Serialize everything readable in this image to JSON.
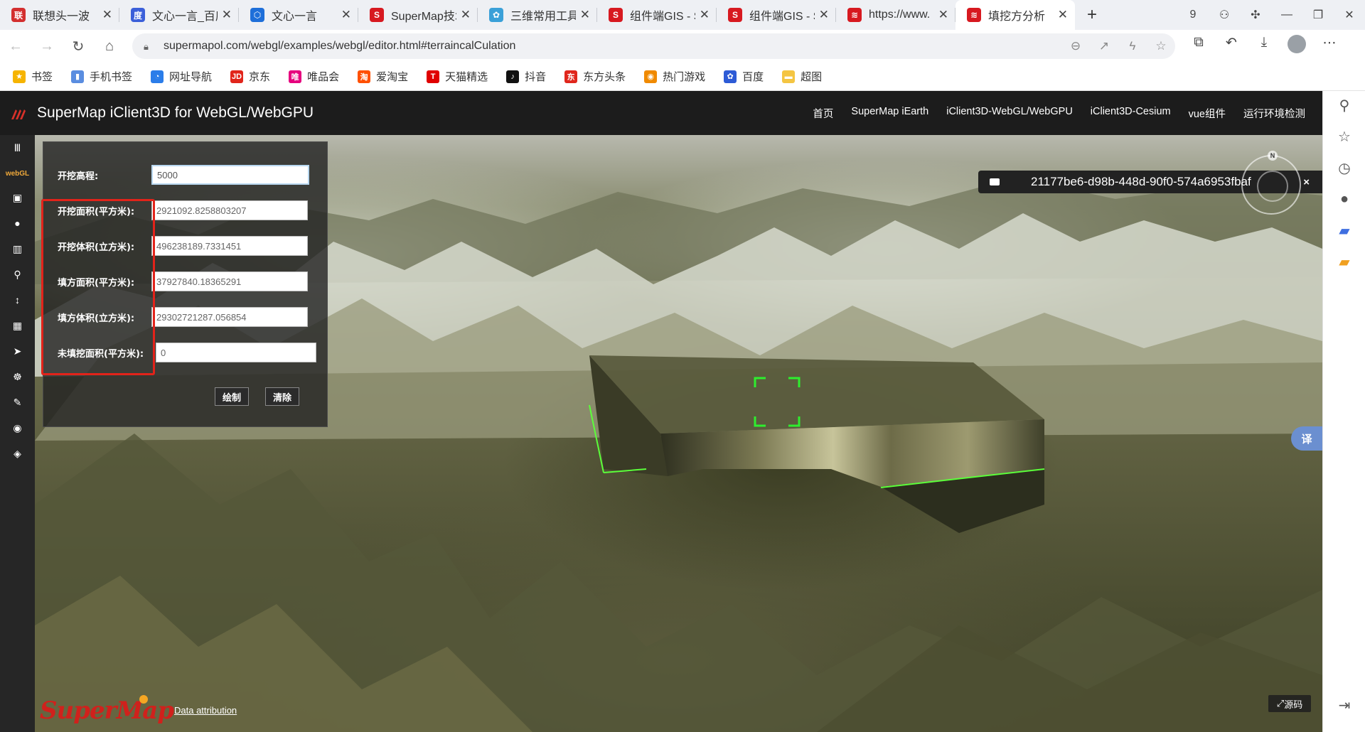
{
  "browser": {
    "tabs": [
      {
        "title": "联想头一波",
        "color": "#d32f2f",
        "glyph": "联"
      },
      {
        "title": "文心一言_百度",
        "color": "#3b5fd9",
        "glyph": "度"
      },
      {
        "title": "文心一言",
        "color": "#1e6fd9",
        "glyph": "⬡"
      },
      {
        "title": "SuperMap技术",
        "color": "#d71920",
        "glyph": "S"
      },
      {
        "title": "三维常用工具",
        "color": "#3aa0d8",
        "glyph": "✿"
      },
      {
        "title": "组件端GIS - S",
        "color": "#d71920",
        "glyph": "S"
      },
      {
        "title": "组件端GIS - S",
        "color": "#d71920",
        "glyph": "S"
      },
      {
        "title": "https://www.",
        "color": "#d71920",
        "glyph": "≋"
      },
      {
        "title": "填挖方分析",
        "color": "#d71920",
        "glyph": "≋",
        "active": true
      }
    ],
    "tab_count_badge": "9",
    "url": "supermapol.com/webgl/examples/webgl/editor.html#terraincalCulation",
    "bookmarks": [
      {
        "label": "书签",
        "color": "#f6b400",
        "glyph": "★"
      },
      {
        "label": "手机书签",
        "color": "#5a8de0",
        "glyph": "▮"
      },
      {
        "label": "网址导航",
        "color": "#2b7de9",
        "glyph": "◔"
      },
      {
        "label": "京东",
        "color": "#e1251b",
        "glyph": "JD"
      },
      {
        "label": "唯品会",
        "color": "#e6007e",
        "glyph": "唯"
      },
      {
        "label": "爱淘宝",
        "color": "#ff5000",
        "glyph": "淘"
      },
      {
        "label": "天猫精选",
        "color": "#e00000",
        "glyph": "T"
      },
      {
        "label": "抖音",
        "color": "#111111",
        "glyph": "♪"
      },
      {
        "label": "东方头条",
        "color": "#e0261c",
        "glyph": "东"
      },
      {
        "label": "热门游戏",
        "color": "#f08a00",
        "glyph": "◉"
      },
      {
        "label": "百度",
        "color": "#2d5bd6",
        "glyph": "✿"
      },
      {
        "label": "超图",
        "color": "#f4c542",
        "glyph": "▬"
      }
    ]
  },
  "app": {
    "title": "SuperMap iClient3D for WebGL/WebGPU",
    "nav": [
      "首页",
      "SuperMap iEarth",
      "iClient3D-WebGL/WebGPU",
      "iClient3D-Cesium",
      "vue组件",
      "运行环境检测"
    ],
    "rail_badge": "webGL"
  },
  "panel": {
    "rows": [
      {
        "label": "开挖高程:",
        "value": "5000"
      },
      {
        "label": "开挖面积(平方米):",
        "value": "2921092.8258803207"
      },
      {
        "label": "开挖体积(立方米):",
        "value": "496238189.7331451"
      },
      {
        "label": "填方面积(平方米):",
        "value": "37927840.18365291"
      },
      {
        "label": "填方体积(立方米):",
        "value": "29302721287.056854"
      },
      {
        "label": "未填挖面积(平方米):",
        "value": "0"
      }
    ],
    "draw_button": "绘制",
    "clear_button": "清除"
  },
  "viewer": {
    "entity_id": "21177be6-d98b-448d-90f0-574a6953fbaf",
    "compass_letter": "N",
    "translate_label": "译",
    "source_label": "源码",
    "attribution": "Data attribution",
    "brand": "SuperMap"
  }
}
